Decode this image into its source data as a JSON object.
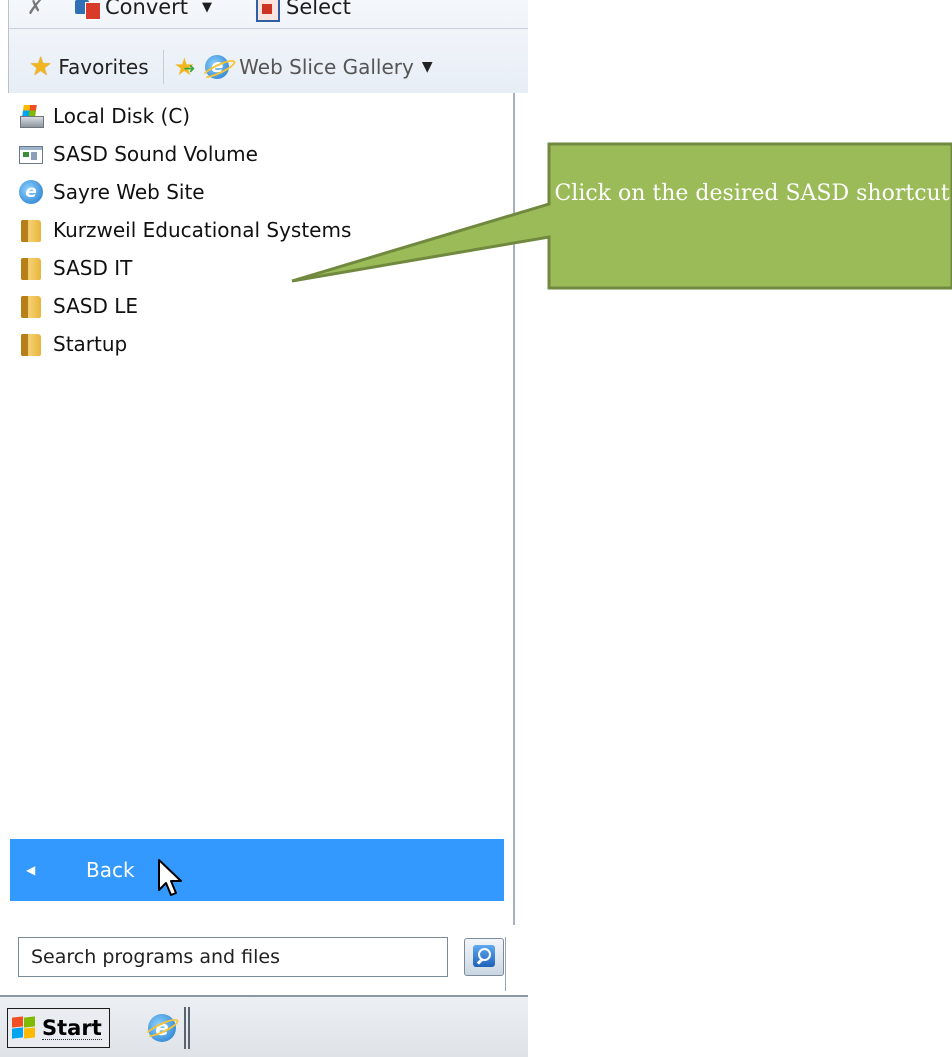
{
  "command_bar": {
    "convert_label": "Convert",
    "select_label": "Select"
  },
  "favorites_bar": {
    "favorites_label": "Favorites",
    "web_slice_label": "Web Slice Gallery"
  },
  "menu": {
    "items": [
      {
        "label": "Local Disk (C)",
        "icon": "local-disk-icon"
      },
      {
        "label": "SASD Sound Volume",
        "icon": "sound-volume-icon"
      },
      {
        "label": "Sayre Web Site",
        "icon": "internet-explorer-icon"
      },
      {
        "label": "Kurzweil Educational Systems",
        "icon": "folder-icon"
      },
      {
        "label": "SASD IT",
        "icon": "folder-icon"
      },
      {
        "label": "SASD LE",
        "icon": "folder-icon"
      },
      {
        "label": "Startup",
        "icon": "folder-icon"
      }
    ],
    "back_label": "Back"
  },
  "search": {
    "placeholder": "Search programs and files"
  },
  "taskbar": {
    "start_label": "Start"
  },
  "callout": {
    "text": "Click on the desired SASD shortcut",
    "fill_color": "#9bbb59",
    "border_color": "#71893f"
  },
  "colors": {
    "selection_blue": "#3399ff"
  }
}
